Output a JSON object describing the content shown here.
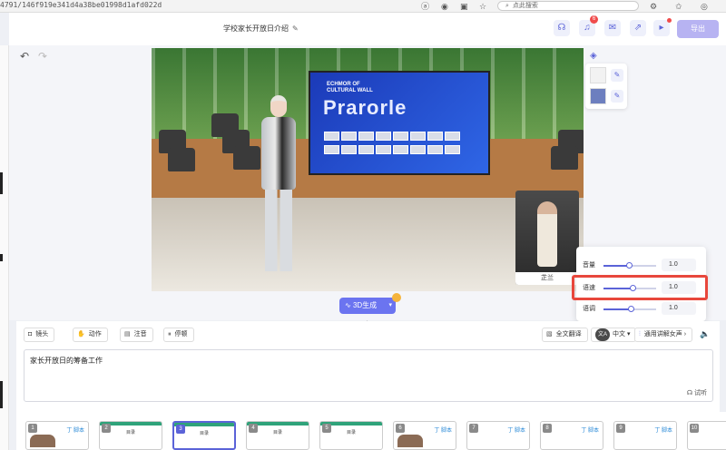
{
  "browser": {
    "url": "4791/146f919e341d4a38be01998d1afd022d",
    "search_placeholder": "点此搜索",
    "icons": [
      "translate-icon",
      "extension-icon",
      "reader-icon",
      "star-icon",
      "settings-icon",
      "favorites-icon",
      "profile-icon"
    ]
  },
  "header": {
    "doc_title": "学校家长开放日介绍",
    "notification_count": "6",
    "export_label": "导出"
  },
  "scene": {
    "screen_subtitle": "ECHMOR OF\nCULTURAL WALL",
    "screen_title": "Prarorle",
    "preview_label": "芷兰"
  },
  "audio_settings": {
    "rows": [
      {
        "label": "音量",
        "value": "1.0",
        "level": 0.48
      },
      {
        "label": "语速",
        "value": "1.0",
        "level": 0.55
      },
      {
        "label": "语调",
        "value": "1.0",
        "level": 0.52
      }
    ]
  },
  "generate": {
    "label": "3D生成"
  },
  "toolbar": {
    "camera": "镜头",
    "action": "动作",
    "note": "注音",
    "pause": "停顿",
    "translate": "全文翻译",
    "language": "中文",
    "voice": "通用讲解女声"
  },
  "script": {
    "text": "家长开放日的筹备工作",
    "audition_label": "试听"
  },
  "slides": [
    {
      "num": "1",
      "caption": "丁 脚本",
      "kind": "photo"
    },
    {
      "num": "2",
      "caption": "目录",
      "kind": "band"
    },
    {
      "num": "3",
      "caption": "目录",
      "kind": "band"
    },
    {
      "num": "4",
      "caption": "目录",
      "kind": "band"
    },
    {
      "num": "5",
      "caption": "目录",
      "kind": "band"
    },
    {
      "num": "6",
      "caption": "丁 脚本",
      "kind": "photo"
    },
    {
      "num": "7",
      "caption": "丁 脚本",
      "kind": "plain"
    },
    {
      "num": "8",
      "caption": "丁 脚本",
      "kind": "plain"
    },
    {
      "num": "9",
      "caption": "丁 脚本",
      "kind": "plain"
    },
    {
      "num": "10",
      "caption": "丁 脚本",
      "kind": "plain"
    }
  ],
  "colors": {
    "accent": "#5b63d8",
    "highlight": "#e8473c",
    "export_btn": "#b7b3f2"
  }
}
